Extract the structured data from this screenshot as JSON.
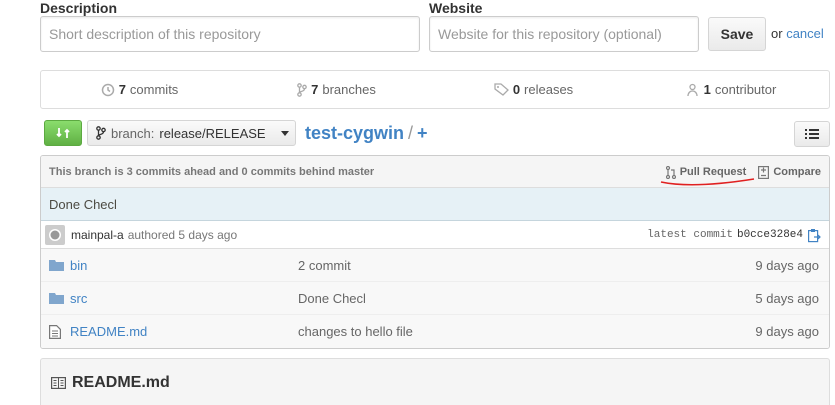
{
  "form": {
    "description_label": "Description",
    "description_placeholder": "Short description of this repository",
    "description_value": "",
    "website_label": "Website",
    "website_placeholder": "Website for this repository (optional)",
    "website_value": "",
    "save_label": "Save",
    "or_text": "or",
    "cancel_label": "cancel"
  },
  "stats": {
    "commits_count": "7",
    "commits_label": "commits",
    "branches_count": "7",
    "branches_label": "branches",
    "releases_count": "0",
    "releases_label": "releases",
    "contributors_count": "1",
    "contributors_label": "contributor"
  },
  "toolbar": {
    "branch_prefix": "branch:",
    "branch_name": "release/RELEASE",
    "repo_name": "test-cygwin",
    "path_sep": "/",
    "add_label": "+"
  },
  "tease": {
    "status": "This branch is 3 commits ahead and 0 commits behind master",
    "pull_request_label": "Pull Request",
    "compare_label": "Compare"
  },
  "last_commit": {
    "message": "Done Checl",
    "author": "mainpal-a",
    "authored_text": "authored 5 days ago",
    "latest_label": "latest commit",
    "sha": "b0cce328e4"
  },
  "files": [
    {
      "type": "folder",
      "name": "bin",
      "message": "2 commit",
      "age": "9 days ago"
    },
    {
      "type": "folder",
      "name": "src",
      "message": "Done Checl",
      "age": "5 days ago"
    },
    {
      "type": "file",
      "name": "README.md",
      "message": "changes to hello file",
      "age": "9 days ago"
    }
  ],
  "readme": {
    "title": "README.md"
  },
  "colors": {
    "link": "#4183c4",
    "compare_green": "#60b044",
    "annotation_red": "#e02020"
  }
}
